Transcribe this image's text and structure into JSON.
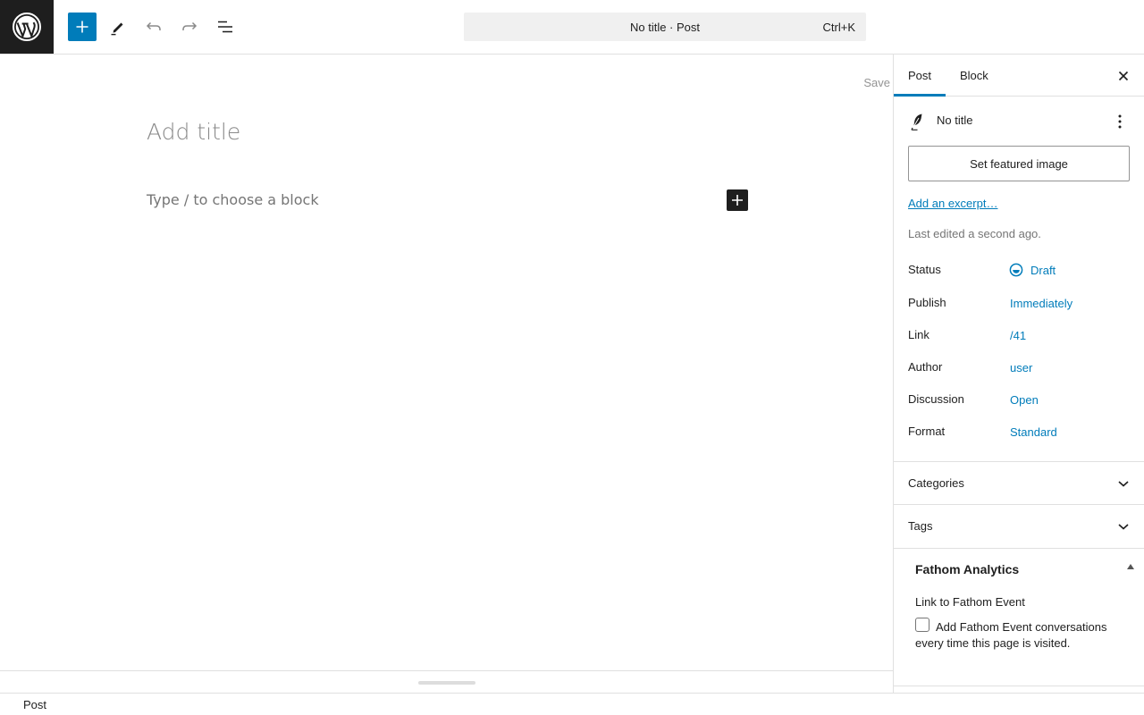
{
  "toolbar": {
    "command_bar_text": "No title · Post",
    "command_shortcut": "Ctrl+K"
  },
  "editor": {
    "save_label": "Save",
    "title_placeholder": "Add title",
    "block_placeholder": "Type / to choose a block"
  },
  "sidebar": {
    "tabs": [
      {
        "label": "Post",
        "active": true
      },
      {
        "label": "Block",
        "active": false
      }
    ],
    "post_title": "No title",
    "featured_image_label": "Set featured image",
    "excerpt_link": "Add an excerpt…",
    "last_edited": "Last edited a second ago.",
    "properties": [
      {
        "label": "Status",
        "value": "Draft"
      },
      {
        "label": "Publish",
        "value": "Immediately"
      },
      {
        "label": "Link",
        "value": "/41"
      },
      {
        "label": "Author",
        "value": "user"
      },
      {
        "label": "Discussion",
        "value": "Open"
      },
      {
        "label": "Format",
        "value": "Standard"
      }
    ],
    "panels": [
      {
        "title": "Categories"
      },
      {
        "title": "Tags"
      }
    ],
    "fathom": {
      "title": "Fathom Analytics",
      "field_label": "Link to Fathom Event",
      "checkbox_label": "Add Fathom Event conversations every time this page is visited.",
      "checked": false
    }
  },
  "footer": {
    "breadcrumb": "Post"
  },
  "colors": {
    "accent": "#007cba",
    "dark": "#1e1e1e",
    "border": "#e0e0e0"
  }
}
